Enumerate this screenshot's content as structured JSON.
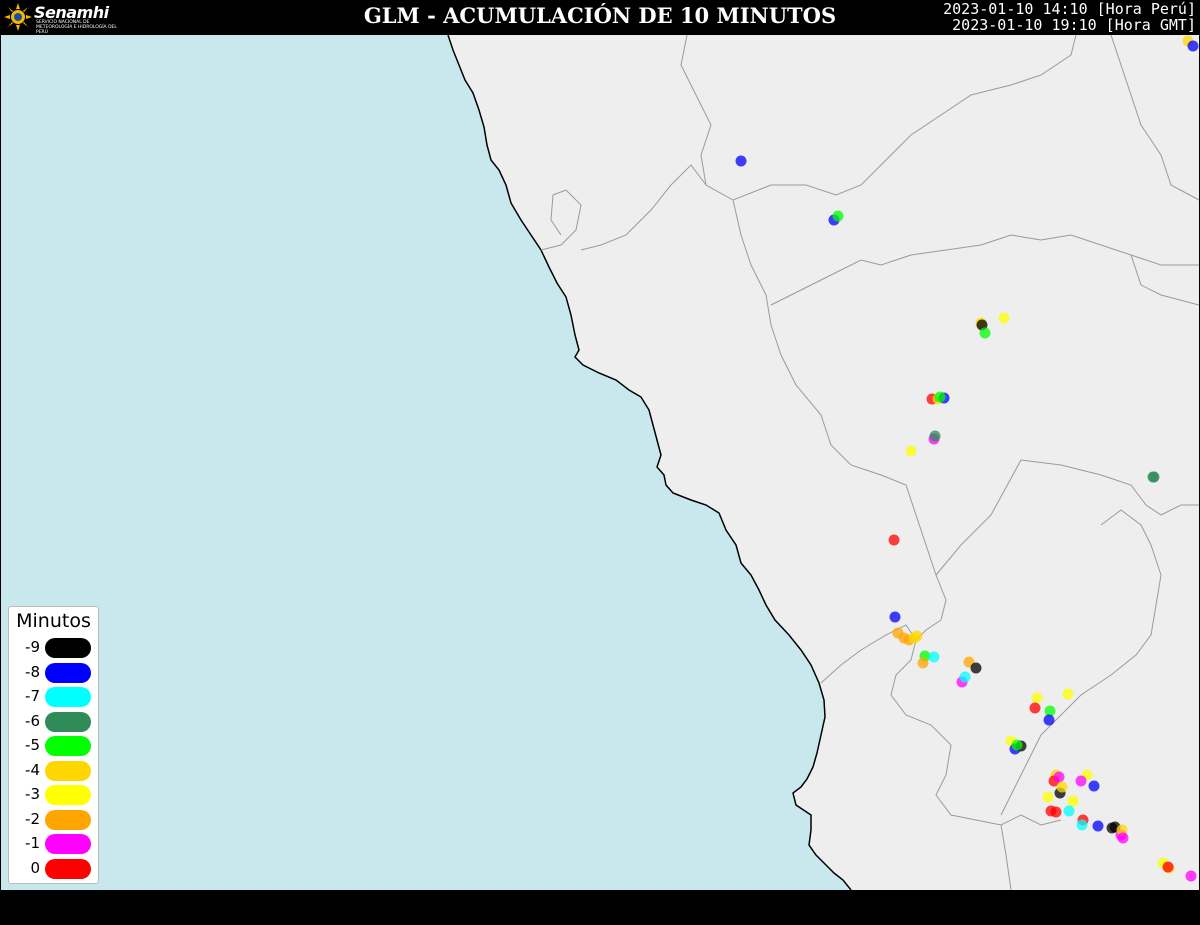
{
  "header": {
    "logo_text": "Senamhi",
    "logo_subtext": "SERVICIO NACIONAL DE METEOROLOGÍA E HIDROLOGÍA DEL PERÚ",
    "title": "GLM - ACUMULACIÓN DE 10 MINUTOS",
    "time_local": "2023-01-10 14:10 [Hora Perú]",
    "time_gmt": "2023-01-10 19:10 [Hora GMT]"
  },
  "colors": {
    "ocean": "#c8e8ee",
    "land": "#eeeeee",
    "coastline": "#000000",
    "boundary": "#9a9a9a",
    "background": "#000000"
  },
  "legend": {
    "title": "Minutos",
    "items": [
      {
        "label": "-9",
        "color": "#000000"
      },
      {
        "label": "-8",
        "color": "#0000ff"
      },
      {
        "label": "-7",
        "color": "#00ffff"
      },
      {
        "label": "-6",
        "color": "#2e8b57"
      },
      {
        "label": "-5",
        "color": "#00ff00"
      },
      {
        "label": "-4",
        "color": "#ffd700"
      },
      {
        "label": "-3",
        "color": "#ffff00"
      },
      {
        "label": "-2",
        "color": "#ffa500"
      },
      {
        "label": "-1",
        "color": "#ff00ff"
      },
      {
        "label": "0",
        "color": "#ff0000"
      }
    ]
  },
  "lightning_events": [
    {
      "minute": -8
    },
    {
      "minute": -8
    },
    {
      "minute": -5
    },
    {
      "minute": -4
    },
    {
      "minute": -9
    },
    {
      "minute": -5
    },
    {
      "minute": -3
    },
    {
      "minute": 0
    },
    {
      "minute": -4
    },
    {
      "minute": -8
    },
    {
      "minute": -5
    },
    {
      "minute": -1
    },
    {
      "minute": -6
    },
    {
      "minute": -3
    },
    {
      "minute": -6
    },
    {
      "minute": 0
    },
    {
      "minute": -8
    },
    {
      "minute": -2
    },
    {
      "minute": -2
    },
    {
      "minute": -2
    },
    {
      "minute": -4
    },
    {
      "minute": -4
    },
    {
      "minute": -5
    },
    {
      "minute": -7
    },
    {
      "minute": -2
    },
    {
      "minute": -2
    },
    {
      "minute": -9
    },
    {
      "minute": -1
    },
    {
      "minute": -7
    },
    {
      "minute": -3
    },
    {
      "minute": -3
    },
    {
      "minute": 0
    },
    {
      "minute": -5
    },
    {
      "minute": -8
    },
    {
      "minute": -3
    },
    {
      "minute": -8
    },
    {
      "minute": -9
    },
    {
      "minute": -5
    },
    {
      "minute": -4
    },
    {
      "minute": 0
    },
    {
      "minute": -1
    },
    {
      "minute": -9
    },
    {
      "minute": -4
    },
    {
      "minute": -3
    },
    {
      "minute": -1
    },
    {
      "minute": -8
    },
    {
      "minute": 0
    },
    {
      "minute": -6
    },
    {
      "minute": -3
    },
    {
      "minute": -3
    },
    {
      "minute": 0
    },
    {
      "minute": -7
    },
    {
      "minute": 0
    },
    {
      "minute": -7
    },
    {
      "minute": -8
    },
    {
      "minute": -9
    },
    {
      "minute": -9
    },
    {
      "minute": -1
    },
    {
      "minute": -4
    },
    {
      "minute": -1
    },
    {
      "minute": -3
    },
    {
      "minute": -4
    },
    {
      "minute": 0
    },
    {
      "minute": -1
    },
    {
      "minute": -4
    },
    {
      "minute": -8
    }
  ]
}
